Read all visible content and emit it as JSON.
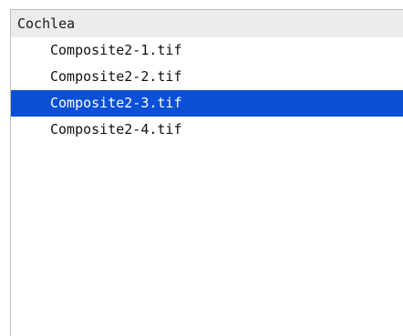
{
  "group": {
    "title": "Cochlea"
  },
  "files": [
    {
      "name": "Composite2-1.tif",
      "selected": false
    },
    {
      "name": "Composite2-2.tif",
      "selected": false
    },
    {
      "name": "Composite2-3.tif",
      "selected": true
    },
    {
      "name": "Composite2-4.tif",
      "selected": false
    }
  ],
  "colors": {
    "selection": "#0a50d6",
    "header_bg": "#ececec"
  }
}
